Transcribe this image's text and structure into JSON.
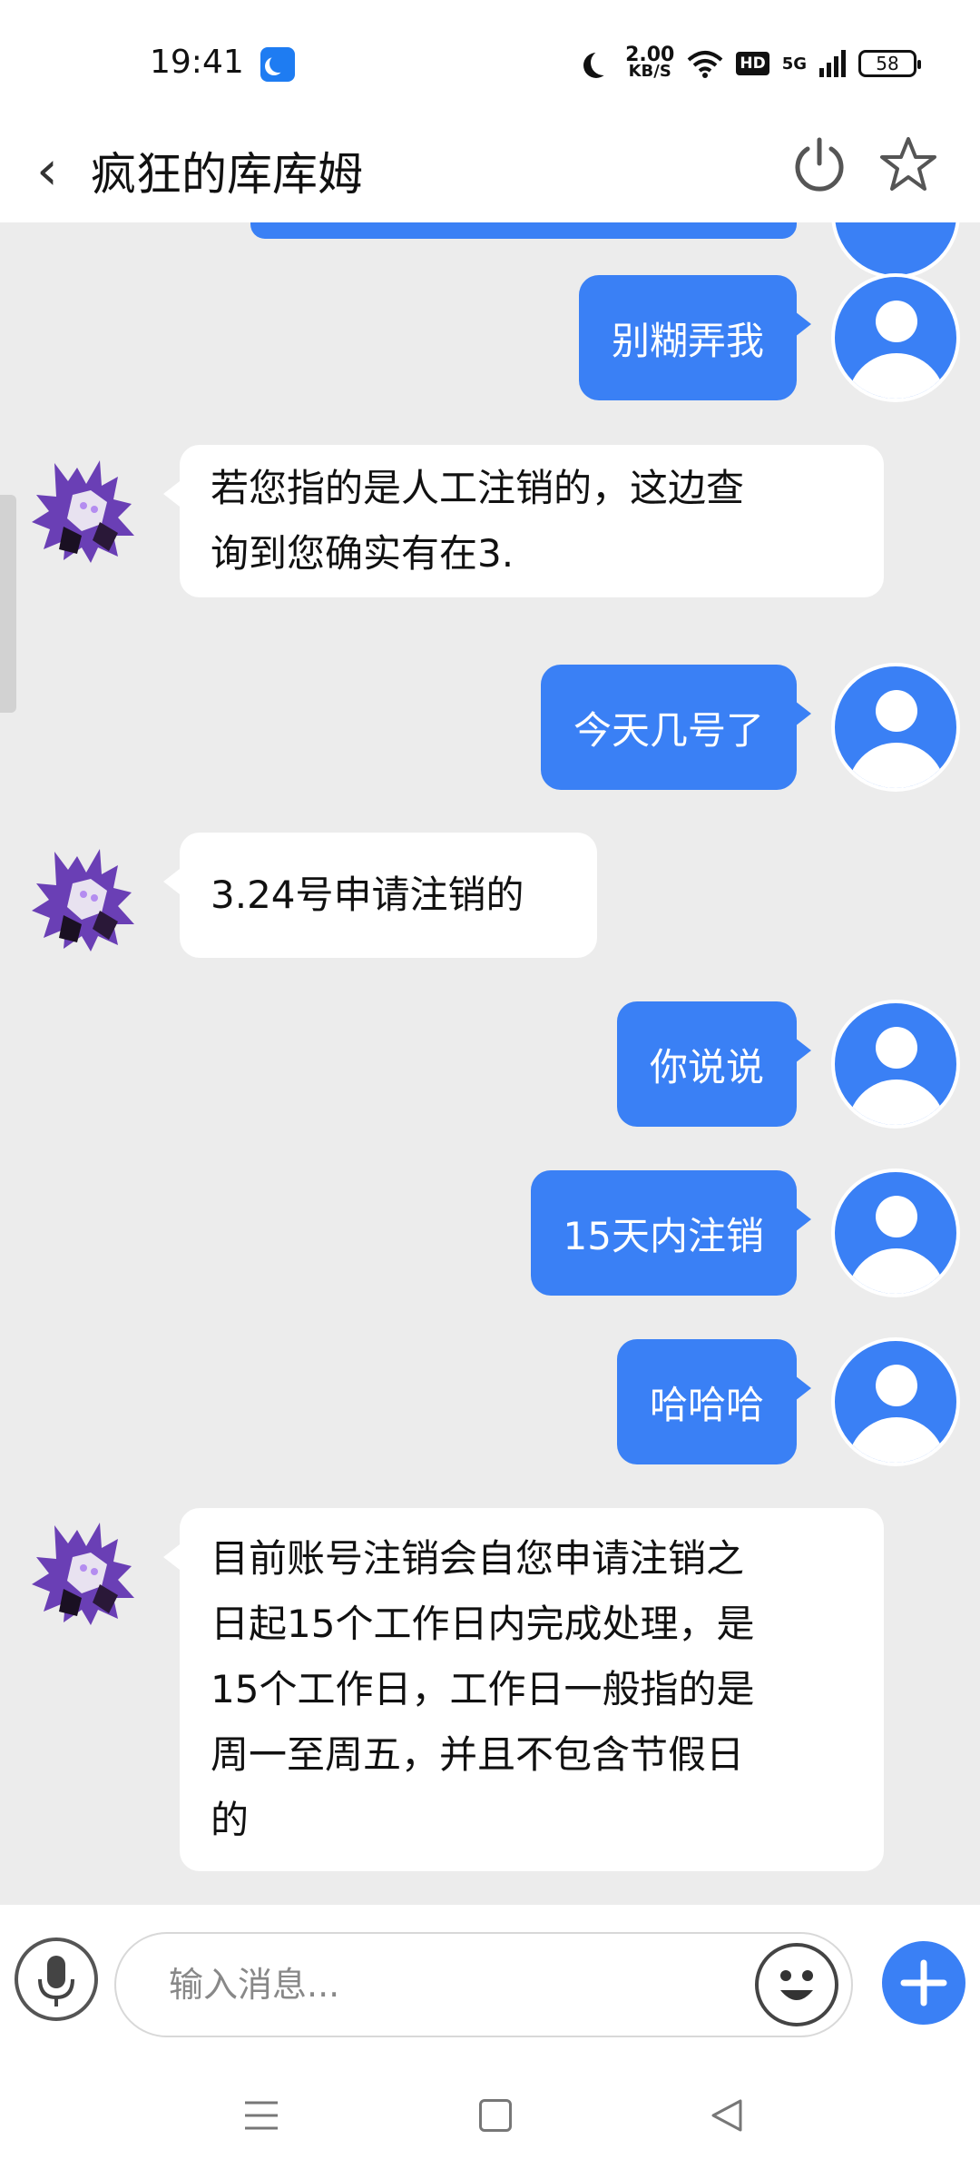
{
  "status_bar": {
    "time": "19:41",
    "speed_value": "2.00",
    "speed_unit": "KB/S",
    "hd_badge": "HD",
    "network": "5G",
    "battery": "58"
  },
  "header": {
    "title": "疯狂的库库姆"
  },
  "messages": [
    {
      "side": "right",
      "text": "别糊弄我"
    },
    {
      "side": "left",
      "lines": [
        "若您指的是人工注销的，这边查",
        "询到您确实有在3."
      ]
    },
    {
      "side": "right",
      "text": "今天几号了"
    },
    {
      "side": "left",
      "lines": [
        "3.24号申请注销的"
      ]
    },
    {
      "side": "right",
      "text": "你说说"
    },
    {
      "side": "right",
      "text": "15天内注销"
    },
    {
      "side": "right",
      "text": "哈哈哈"
    },
    {
      "side": "left",
      "lines": [
        "目前账号注销会自您申请注销之",
        "日起15个工作日内完成处理，是",
        "15个工作日，工作日一般指的是",
        "周一至周五，并且不包含节假日",
        "的"
      ]
    }
  ],
  "input": {
    "placeholder": "输入消息..."
  },
  "colors": {
    "accent": "#3a80f5",
    "chat_background": "#ececec",
    "bot_avatar_purple": "#6a3fb5"
  },
  "icons": {
    "back": "chevron-left-icon",
    "power": "power-icon",
    "favorite": "star-icon",
    "voice": "microphone-icon",
    "emoji": "smiley-icon",
    "more": "plus-icon"
  }
}
